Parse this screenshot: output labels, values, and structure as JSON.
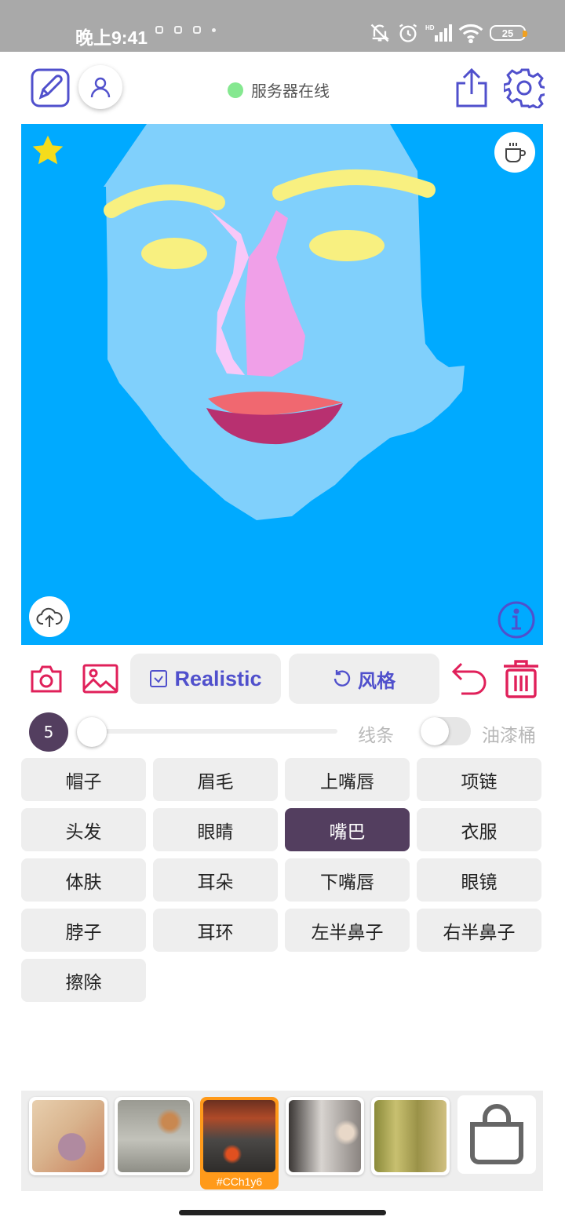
{
  "status_bar": {
    "time": "晚上9:41",
    "battery": "25"
  },
  "header": {
    "server_status": "服务器在线",
    "server_color": "#85e890"
  },
  "canvas": {
    "background": "#00aaff",
    "icons": [
      "star-icon",
      "coffee-cup-icon",
      "cloud-upload-icon",
      "info-icon"
    ]
  },
  "toolbar": {
    "realistic_label": "Realistic",
    "style_label": "风格",
    "icons": [
      "camera-icon",
      "image-icon",
      "undo-icon",
      "trash-icon"
    ]
  },
  "brush": {
    "size": "5",
    "line_label": "线条",
    "bucket_label": "油漆桶"
  },
  "parts": [
    {
      "label": "帽子"
    },
    {
      "label": "眉毛"
    },
    {
      "label": "上嘴唇"
    },
    {
      "label": "项链"
    },
    {
      "label": "头发"
    },
    {
      "label": "眼睛"
    },
    {
      "label": "嘴巴"
    },
    {
      "label": "衣服"
    },
    {
      "label": "体肤"
    },
    {
      "label": "耳朵"
    },
    {
      "label": "下嘴唇"
    },
    {
      "label": "眼镜"
    },
    {
      "label": "脖子"
    },
    {
      "label": "耳环"
    },
    {
      "label": "左半鼻子"
    },
    {
      "label": "右半鼻子"
    },
    {
      "label": "擦除"
    }
  ],
  "selected_part": "嘴巴",
  "thumbnails": {
    "selected_code": "#CCh1y6"
  },
  "colors": {
    "accent": "#533e5f",
    "icon_blue": "#5050cc",
    "icon_red": "#e0205a",
    "selected_thumb": "#ff9a1a"
  }
}
